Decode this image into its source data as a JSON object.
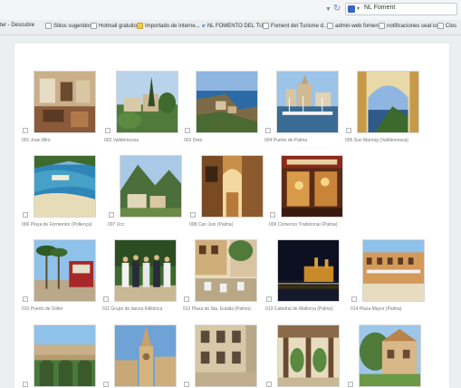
{
  "browser": {
    "search_value": "NL Foment"
  },
  "bookmarks": [
    {
      "label": "ter - Descubre",
      "icon": "bookmark-page-icon"
    },
    {
      "label": "Sitios sugeridos",
      "icon": "bookmark-page-icon"
    },
    {
      "label": "Hotmail gratuito",
      "icon": "bookmark-page-icon"
    },
    {
      "label": "Importado de Interne...",
      "icon": "folder-icon"
    },
    {
      "label": "NL FOMENTO DEL TU...",
      "icon": "ie-page-icon"
    },
    {
      "label": "Foment del Turisme d...",
      "icon": "bookmark-page-icon"
    },
    {
      "label": "admin-web foment",
      "icon": "bookmark-page-icon"
    },
    {
      "label": "notificaciones seat io...",
      "icon": "bookmark-page-icon"
    },
    {
      "label": "Clos",
      "icon": "bookmark-page-icon"
    }
  ],
  "colors": {
    "page_bg": "#ffffff",
    "window_bg": "#eceff1",
    "caption": "#777777"
  },
  "gallery": [
    {
      "caption": "001 Joan Miró",
      "scene": "interior"
    },
    {
      "caption": "002 Valldemossa",
      "scene": "village"
    },
    {
      "caption": "003 Deià",
      "scene": "coast"
    },
    {
      "caption": "004 Puerto de Palma",
      "scene": "harbor"
    },
    {
      "caption": "005 Son Marroig (Valldemossa)",
      "scene": "arch"
    },
    {
      "caption": "006 Playa de Formentor (Pollença)",
      "scene": "beach"
    },
    {
      "caption": "007 Ucc",
      "scene": "mountain"
    },
    {
      "caption": "008 Can Juni (Palma)",
      "scene": "courtyard"
    },
    {
      "caption": "009 Comercio Tradicional (Palma)",
      "scene": "shop"
    },
    {
      "caption": "010 Puerto de Sóller",
      "scene": "tram"
    },
    {
      "caption": "011 Grupo de danza folklórica",
      "scene": "dancers"
    },
    {
      "caption": "012 Plaza de Sta. Eulalia (Palma)",
      "scene": "plaza"
    },
    {
      "caption": "013 Catedral de Mallorca (Palma)",
      "scene": "night"
    },
    {
      "caption": "014 Plaza Mayor (Palma)",
      "scene": "square"
    },
    {
      "caption": "",
      "scene": "bridge"
    },
    {
      "caption": "",
      "scene": "church"
    },
    {
      "caption": "",
      "scene": "facade"
    },
    {
      "caption": "",
      "scene": "cloister"
    },
    {
      "caption": "",
      "scene": "mansion"
    }
  ]
}
